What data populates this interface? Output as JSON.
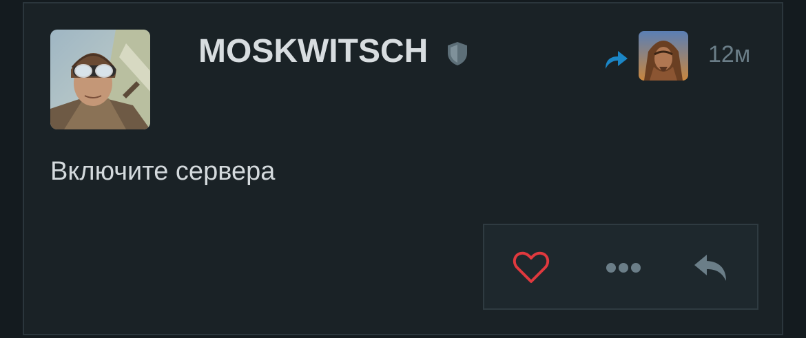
{
  "post": {
    "username": "MOSKWITSCH",
    "timestamp": "12м",
    "message": "Включите сервера"
  },
  "icons": {
    "verified": "shield-icon",
    "repost": "repost-arrow-icon",
    "like": "heart-icon",
    "more": "more-dots-icon",
    "reply": "reply-icon"
  },
  "colors": {
    "background": "#141b1f",
    "card": "#1a2226",
    "accent_blue": "#1b86c6",
    "like_red": "#e0393e",
    "muted": "#6b7e88",
    "text": "#d8dde0"
  }
}
